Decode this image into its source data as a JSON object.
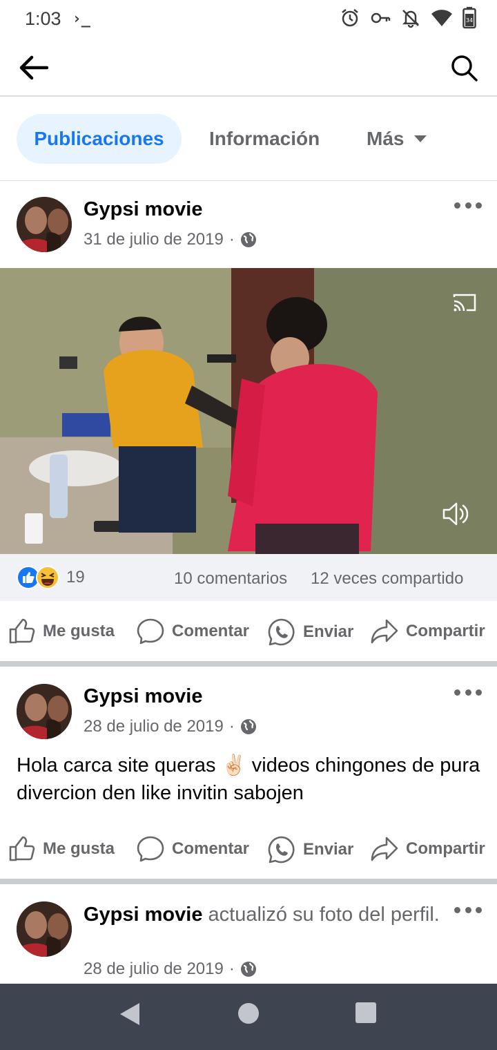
{
  "status_bar": {
    "time": "1:03",
    "terminal_glyph": "›_",
    "icons": [
      "alarm-icon",
      "vpn-key-icon",
      "notifications-off-icon",
      "wifi-icon",
      "battery-icon"
    ],
    "battery_level": "34"
  },
  "app_bar": {
    "back_icon": "back-arrow-icon",
    "search_icon": "search-icon"
  },
  "tabs": {
    "posts": "Publicaciones",
    "info": "Información",
    "more": "Más"
  },
  "posts": [
    {
      "author": "Gypsi movie",
      "date": "31 de julio de 2019",
      "privacy_icon": "globe-icon",
      "media": "video",
      "stats": {
        "reactions": "19",
        "comments": "10 comentarios",
        "shares": "12 veces compartido"
      }
    },
    {
      "author": "Gypsi movie",
      "date": "28 de julio de 2019",
      "privacy_icon": "globe-icon",
      "text": "Hola carca site queras ✌🏻 videos chingones de pura divercion den like invitin sabojen"
    },
    {
      "author": "Gypsi movie",
      "action": "actualizó su foto del perfil.",
      "date": "28 de julio de 2019",
      "privacy_icon": "globe-icon"
    }
  ],
  "actions": {
    "like": "Me gusta",
    "comment": "Comentar",
    "send": "Enviar",
    "share": "Compartir"
  },
  "colors": {
    "accent": "#1877f2",
    "tab_active_bg": "#e7f3ff",
    "secondary_text": "#65676b",
    "separator": "#c9ccd1",
    "nav_bar": "#3e4450"
  }
}
